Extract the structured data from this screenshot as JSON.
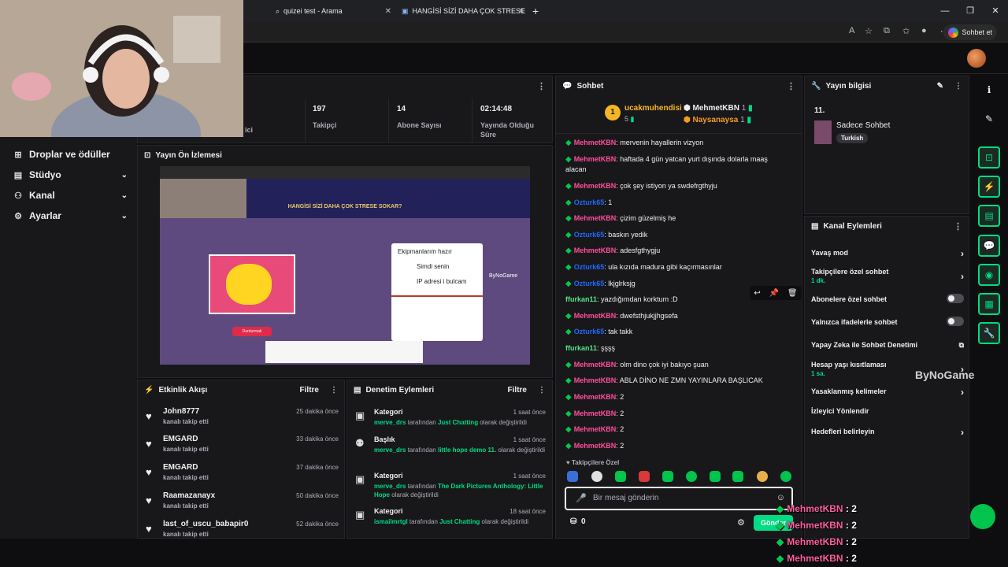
{
  "browser": {
    "tabs": [
      {
        "title": "quizei test - Arama"
      },
      {
        "title": "HANGİSİ SİZİ DAHA ÇOK STRESE S"
      }
    ],
    "new_tab": "+",
    "sohbet_et": "Sohbet et"
  },
  "sidebar": {
    "items": [
      {
        "label": "Droplar ve ödüller",
        "icon": "gift-icon"
      },
      {
        "label": "Stüdyo",
        "icon": "layout-icon"
      },
      {
        "label": "Kanal",
        "icon": "users-icon"
      },
      {
        "label": "Ayarlar",
        "icon": "gear-icon"
      }
    ]
  },
  "stats": {
    "partial_label": "ici",
    "items": [
      {
        "value": "197",
        "label": "Takipçi"
      },
      {
        "value": "14",
        "label": "Abone Sayısı"
      },
      {
        "value": "02:14:48",
        "label": "Yayında Olduğu Süre"
      }
    ]
  },
  "preview": {
    "title": "Yayın Ön İzlemesi",
    "heading": "HANGİSİ SİZİ DAHA ÇOK STRESE SOKAR?",
    "popup_lines": [
      "Ekipmanlarım hazır",
      "Simdi senin",
      "IP adresi i bulcam"
    ],
    "watermark": "ByNoGame",
    "button_red": "Durdurmak"
  },
  "activity": {
    "title": "Etkinlik Akışı",
    "filter": "Filtre",
    "items": [
      {
        "name": "John8777",
        "action": "kanalı takip etti",
        "time": "25 dakika önce"
      },
      {
        "name": "EMGARD",
        "action": "kanalı takip etti",
        "time": "33 dakika önce"
      },
      {
        "name": "EMGARD",
        "action": "kanalı takip etti",
        "time": "37 dakika önce"
      },
      {
        "name": "Raamazanayx",
        "action": "kanalı takip etti",
        "time": "50 dakika önce"
      },
      {
        "name": "last_of_uscu_babapir0",
        "action": "kanalı takip etti",
        "time": "52 dakika önce"
      }
    ]
  },
  "moderation": {
    "title": "Denetim Eylemleri",
    "filter": "Filtre",
    "items": [
      {
        "type": "Kategori",
        "time": "1 saat önce",
        "user": "merve_drs",
        "by": " tarafından ",
        "value": "Just Chatting",
        "suffix": " olarak değiştirildi"
      },
      {
        "type": "Başlık",
        "time": "1 saat önce",
        "user": "merve_drs",
        "by": " tarafından ",
        "value": "little hope demo 11.",
        "suffix": " olarak değiştirildi"
      },
      {
        "type": "Kategori",
        "time": "1 saat önce",
        "user": "merve_drs",
        "by": " tarafından ",
        "value": "The Dark Pictures Anthology: Little Hope",
        "suffix": " olarak değiştirildi"
      },
      {
        "type": "Kategori",
        "time": "18 saat önce",
        "user": "ismailmrtgl",
        "by": " tarafından ",
        "value": "Just Chatting",
        "suffix": " olarak değiştirildi"
      }
    ]
  },
  "chat": {
    "title": "Sohbet",
    "leader": {
      "name": "ucakmuhendisi",
      "count": "5",
      "rank": "1"
    },
    "gifters": [
      {
        "name": "MehmetKBN",
        "count": "1"
      },
      {
        "name": "Naysanaysa",
        "count": "1"
      }
    ],
    "messages": [
      {
        "user": "MehmetKBN",
        "text": ": mervenin hayallerin vizyon",
        "kind": "mehmet"
      },
      {
        "user": "MehmetKBN",
        "text": ": haftada 4 gün yatcan yurt dışında dolarla maaş alacan",
        "kind": "mehmet"
      },
      {
        "user": "MehmetKBN",
        "text": ": çok şey istiyon ya swdefrgthyju",
        "kind": "mehmet"
      },
      {
        "user": "Ozturk65",
        "text": ": 1",
        "kind": "ozturk"
      },
      {
        "user": "MehmetKBN",
        "text": ": çizim güzelmiş he",
        "kind": "mehmet"
      },
      {
        "user": "Ozturk65",
        "text": ": baskın yedik",
        "kind": "ozturk"
      },
      {
        "user": "MehmetKBN",
        "text": ": adesfgthygju",
        "kind": "mehmet"
      },
      {
        "user": "Ozturk65",
        "text": ": ula kızıda madura gibi kaçırmasınlar",
        "kind": "ozturk"
      },
      {
        "user": "Ozturk65",
        "text": ": lkjglrksjg",
        "kind": "ozturk"
      },
      {
        "user": "ffurkan11",
        "text": ": yazdığımdan korktum :D",
        "kind": "ffurkan"
      },
      {
        "user": "MehmetKBN",
        "text": ": dwefsthjukjjhgsefa",
        "kind": "mehmet"
      },
      {
        "user": "Ozturk65",
        "text": ": tak takk",
        "kind": "ozturk"
      },
      {
        "user": "ffurkan11",
        "text": ": şşşş",
        "kind": "ffurkan"
      },
      {
        "user": "MehmetKBN",
        "text": ": olm dino çok iyi bakıyo şuan",
        "kind": "mehmet"
      },
      {
        "user": "MehmetKBN",
        "text": ": ABLA DİNO NE ZMN YAYINLARA BAŞLICAK",
        "kind": "mehmet"
      },
      {
        "user": "MehmetKBN",
        "text": ": 2",
        "kind": "mehmet"
      },
      {
        "user": "MehmetKBN",
        "text": ": 2",
        "kind": "mehmet"
      },
      {
        "user": "MehmetKBN",
        "text": ": 2",
        "kind": "mehmet"
      },
      {
        "user": "MehmetKBN",
        "text": ": 2",
        "kind": "mehmet"
      }
    ],
    "followers_label": "Takipçilere Özel",
    "input_placeholder": "Bir mesaj gönderin",
    "points": "0",
    "send_label": "Gönder"
  },
  "stream_info": {
    "title": "Yayın bilgisi",
    "number": "11.",
    "category": "Sadece Sohbet",
    "tag": "Turkish"
  },
  "channel_actions": {
    "title": "Kanal Eylemleri",
    "items": [
      {
        "label": "Yavaş mod",
        "control": "chevron"
      },
      {
        "label": "Takipçilere özel sohbet",
        "sub": "1 dk.",
        "control": "chevron"
      },
      {
        "label": "Abonelere özel sohbet",
        "control": "toggle"
      },
      {
        "label": "Yalnızca ifadelerle sohbet",
        "control": "toggle"
      },
      {
        "label": "Yapay Zeka ile Sohbet Denetimi",
        "control": "external"
      },
      {
        "label": "Hesap yaşı kısıtlaması",
        "sub": "1 sa.",
        "control": "chevron"
      },
      {
        "label": "Yasaklanmış kelimeler",
        "control": "chevron"
      },
      {
        "label": "İzleyici Yönlendir",
        "control": "none"
      },
      {
        "label": "Hedefleri belirleyin",
        "control": "chevron"
      }
    ]
  },
  "watermark": "ByNoGame",
  "overlay": [
    {
      "user": "MehmetKBN",
      "text": "2"
    },
    {
      "user": "MehmetKBN",
      "text": "2"
    },
    {
      "user": "MehmetKBN",
      "text": "2"
    },
    {
      "user": "MehmetKBN",
      "text": "2"
    }
  ],
  "colors": {
    "accent": "#00db84",
    "mehmet": "#ff4f9b",
    "ozturk": "#1f69ff",
    "ffurkan": "#57e389"
  }
}
